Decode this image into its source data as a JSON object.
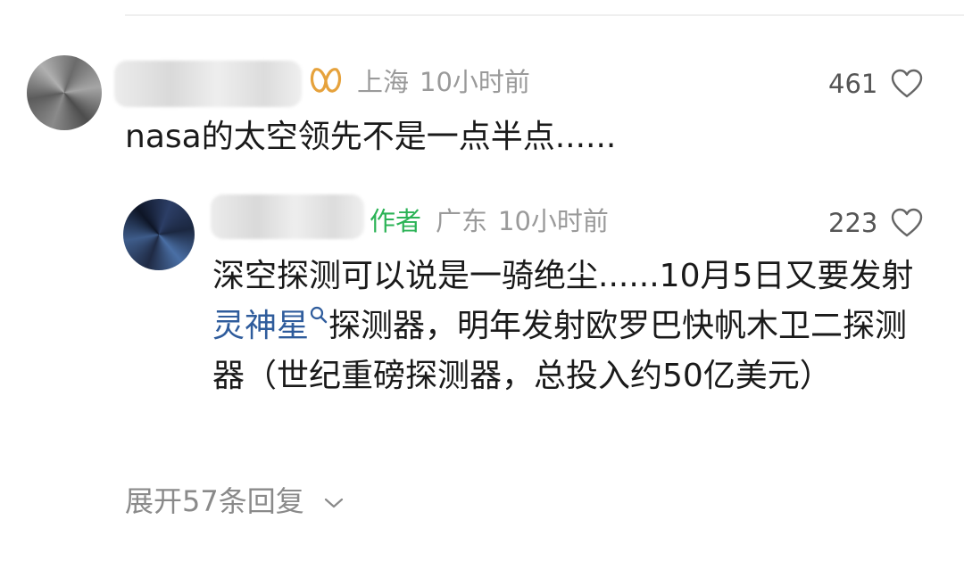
{
  "comment": {
    "location": "上海",
    "time": "10小时前",
    "likes": "461",
    "text": "nasa的太空领先不是一点半点......",
    "vip_icon": "vip-badge-icon"
  },
  "reply": {
    "author_tag": "作者",
    "location": "广东",
    "time": "10小时前",
    "likes": "223",
    "text_before_link": "深空探测可以说是一骑绝尘......10月5日又要发射",
    "link_text": "灵神星",
    "text_after_link": "探测器，明年发射欧罗巴快帆木卫二探测器（世纪重磅探测器，总投入约50亿美元）"
  },
  "expand_replies": {
    "label": "展开57条回复"
  },
  "colors": {
    "author_green": "#2bb356",
    "link_blue": "#2f5c9c",
    "vip_gold": "#e6a23c"
  }
}
